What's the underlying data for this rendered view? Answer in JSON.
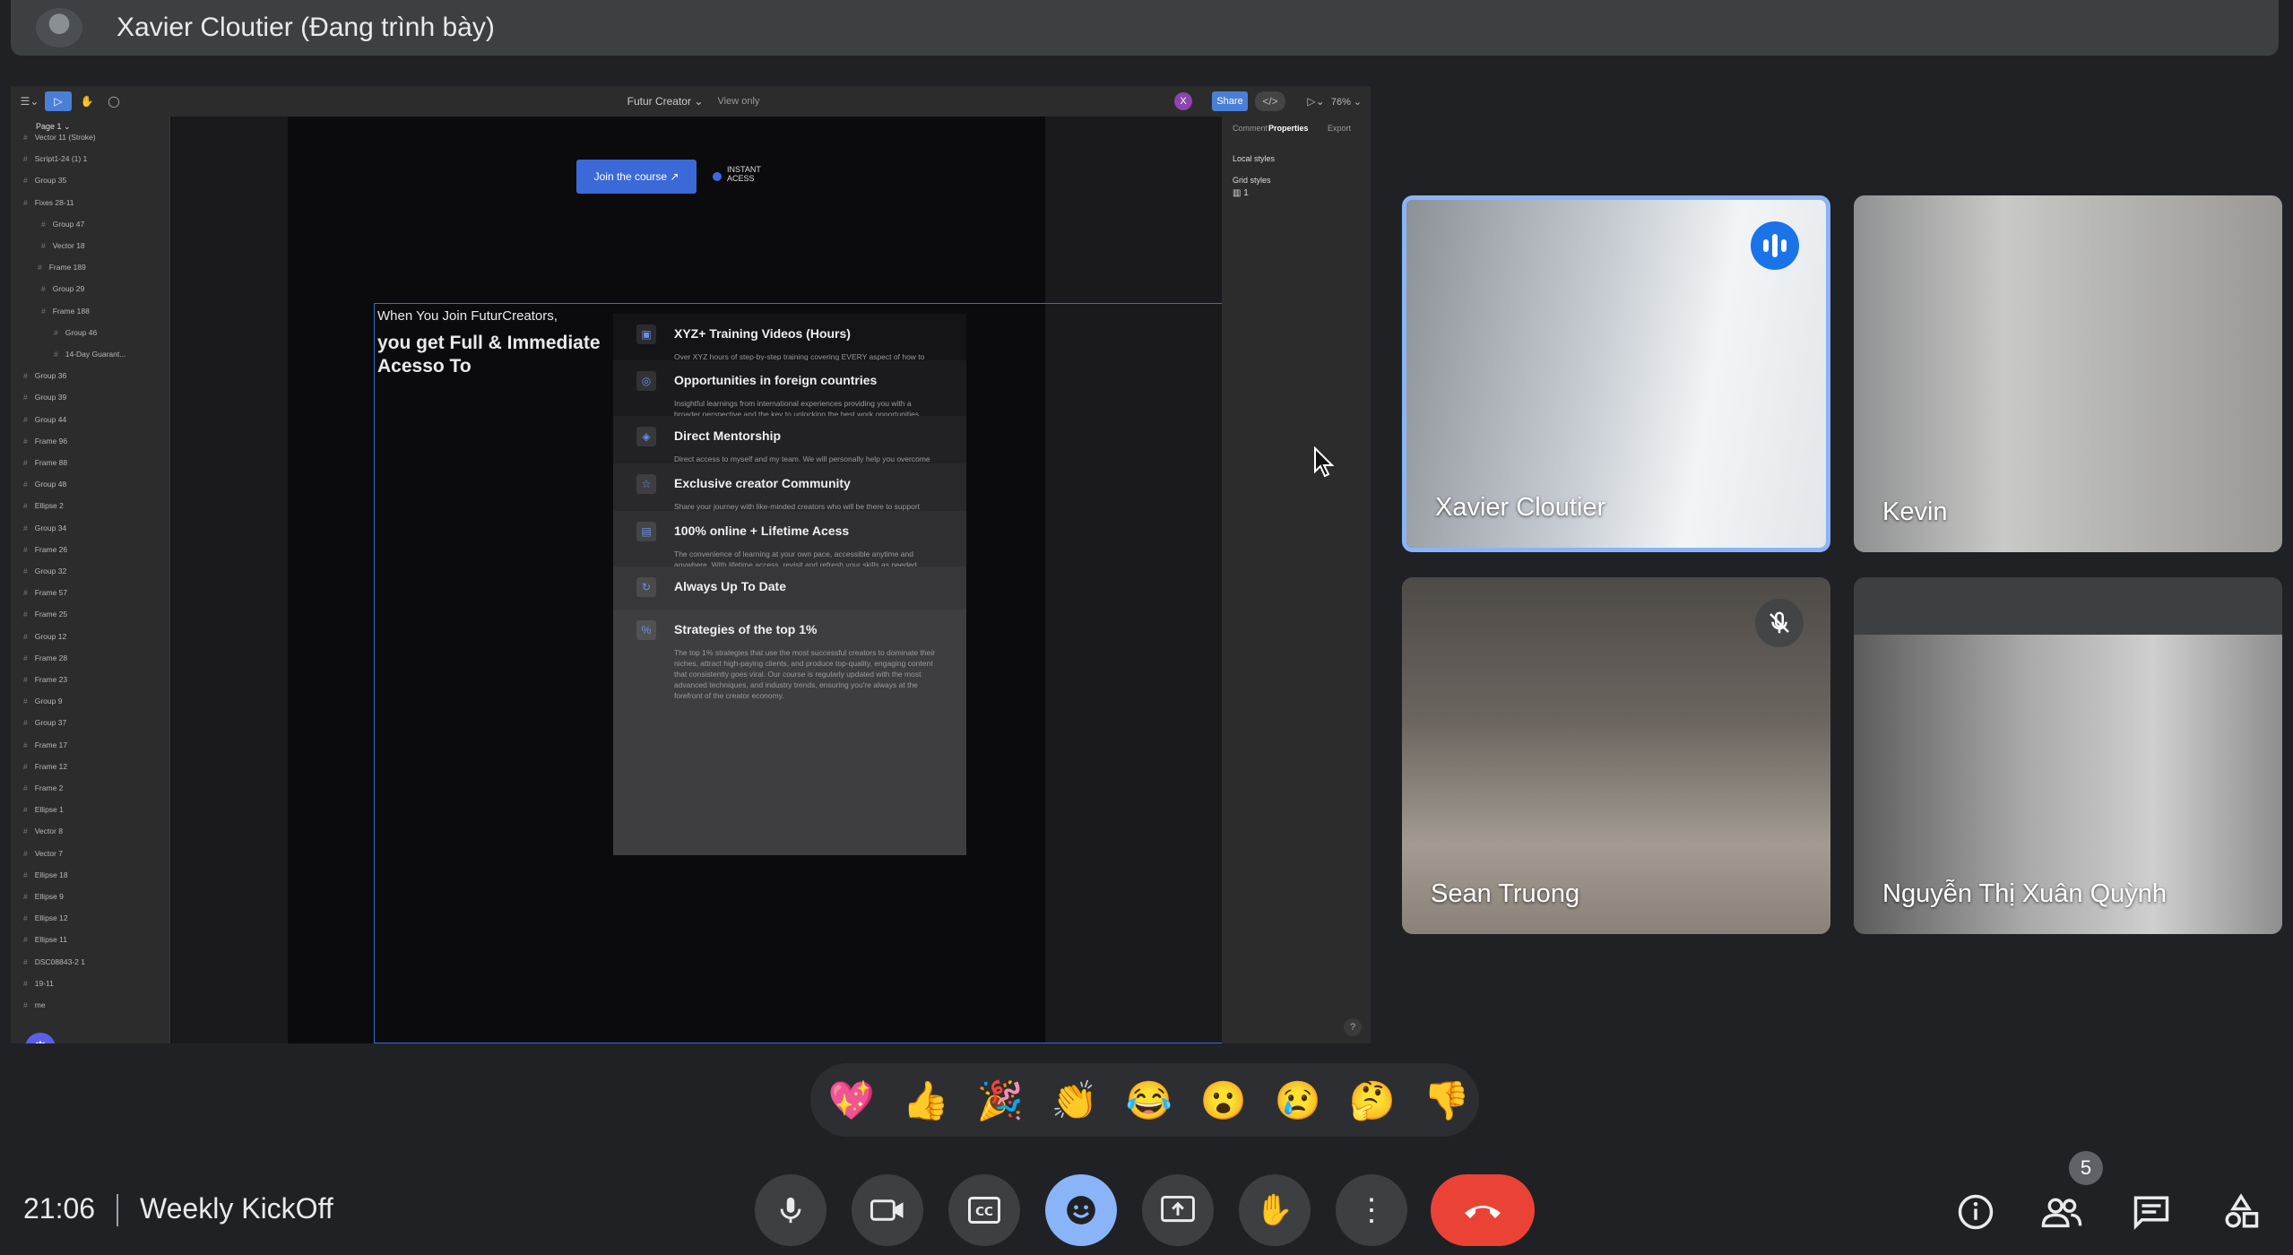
{
  "presenter": {
    "label": "Xavier Cloutier (Đang trình bày)"
  },
  "figma": {
    "filename": "Futur Creator ⌄",
    "view_mode": "View only",
    "user_initial": "X",
    "share_label": "Share",
    "zoom": "76% ⌄",
    "page": "Page 1 ⌄",
    "layers": [
      "Vector 11 (Stroke)",
      "Script1-24 (1) 1",
      "Group 35",
      "Fixes 28-11",
      "Group 47",
      "Vector 18",
      "Frame 189",
      "Group 29",
      "Frame 188",
      "Group 46",
      "14-Day Guarant...",
      "Group 36",
      "Group 39",
      "Group 44",
      "Frame 96",
      "Frame 88",
      "Group 48",
      "Ellipse 2",
      "Group 34",
      "Frame 26",
      "Group 32",
      "Frame 57",
      "Frame 25",
      "Group 12",
      "Frame 28",
      "Frame 23",
      "Group 9",
      "Group 37",
      "Frame 17",
      "Frame 12",
      "Frame 2",
      "Ellipse 1",
      "Vector 8",
      "Vector 7",
      "Ellipse 18",
      "Ellipse 9",
      "Ellipse 12",
      "Ellipse 11",
      "DSC08843-2 1",
      "19-11",
      "me"
    ],
    "right_tabs": [
      "Comment",
      "Properties",
      "Export"
    ],
    "local_styles": "Local styles",
    "grid_styles": "Grid styles",
    "grid_icon": "▥ 1",
    "help": "?",
    "canvas": {
      "join_button": "Join the course ↗",
      "instant_label": "INSTANT ACESS",
      "intro": "When You Join FuturCreators,",
      "heading": "you get Full & Immediate Acesso To",
      "features": [
        {
          "icon": "▣",
          "title": "XYZ+ Training Videos (Hours)",
          "desc": "Over XYZ hours of step-by-step training covering EVERY aspect of how to become..."
        },
        {
          "icon": "◎",
          "title": "Opportunities in foreign countries",
          "desc": "Insightful learnings from international experiences providing you with a broader perspective and the key to unlocking the best work opportunities around the world."
        },
        {
          "icon": "◈",
          "title": "Direct Mentorship",
          "desc": "Direct access to myself and my team. We will personally help you overcome the..."
        },
        {
          "icon": "☆",
          "title": "Exclusive creator Community",
          "desc": "Share your journey with like-minded creators who will be there to support you..."
        },
        {
          "icon": "▤",
          "title": "100% online + Lifetime Acess",
          "desc": "The convenience of learning at your own pace, accessible anytime and anywhere. With lifetime access, revisit and refresh your skills as needed, keeping your..."
        },
        {
          "icon": "↻",
          "title": "Always Up To Date",
          "desc": ""
        },
        {
          "icon": "%",
          "title": "Strategies of the top 1%",
          "desc": "The top 1% strategies that use the most successful creators to dominate their niches, attract high-paying clients, and produce top-quality, engaging content that consistently goes viral. Our course is regularly updated with the most advanced techniques, and industry trends, ensuring you're always at the forefront of the creator economy."
        }
      ]
    }
  },
  "participants": [
    {
      "name": "Xavier Cloutier",
      "status": "speaking"
    },
    {
      "name": "Kevin",
      "status": ""
    },
    {
      "name": "Sean Truong",
      "status": "muted"
    },
    {
      "name": "Nguyễn Thị Xuân Quỳnh",
      "status": ""
    }
  ],
  "reactions": [
    "💖",
    "👍",
    "🎉",
    "👏",
    "😂",
    "😮",
    "😢",
    "🤔",
    "👎"
  ],
  "bottom": {
    "time": "21:06",
    "meeting_title": "Weekly KickOff",
    "people_count": "5"
  },
  "colors": {
    "accent": "#8ab4f8",
    "end_call": "#ea4335",
    "speaking": "#1a73e8",
    "background": "#202124"
  }
}
